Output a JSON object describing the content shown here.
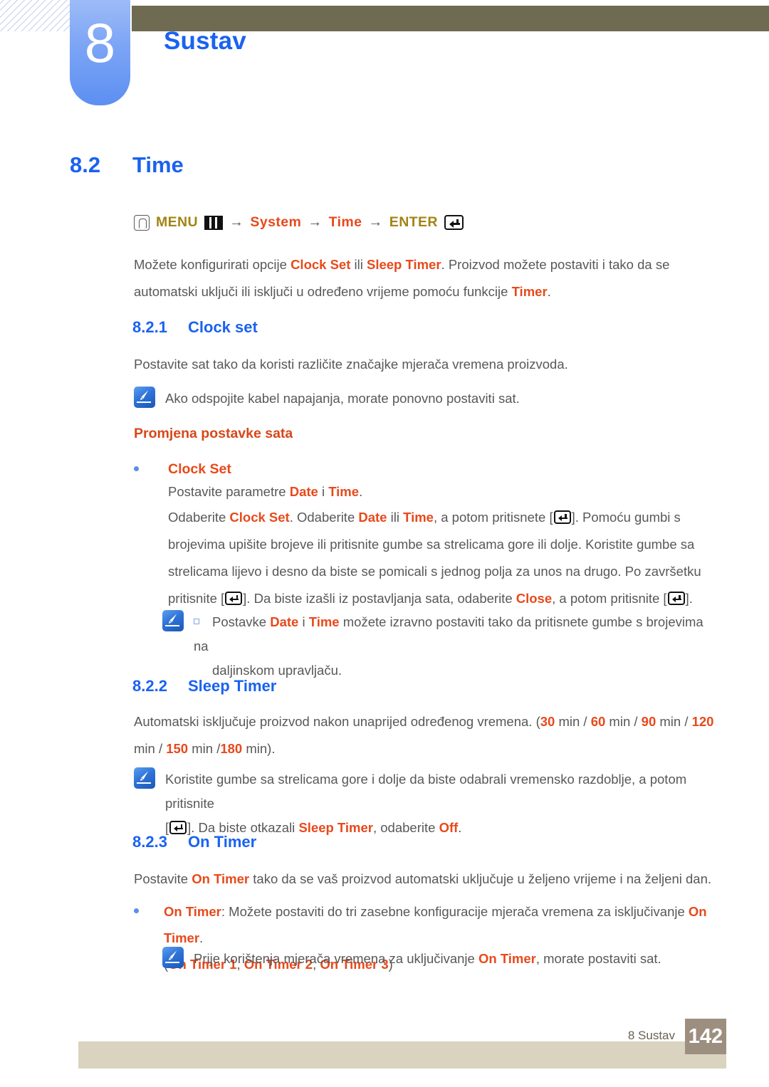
{
  "header": {
    "chapter_number": "8",
    "chapter_title": "Sustav"
  },
  "section": {
    "number": "8.2",
    "title": "Time"
  },
  "menu_path": {
    "menu_label": "MENU",
    "item1": "System",
    "item2": "Time",
    "enter_label": "ENTER",
    "arrow": "→",
    "icons": [
      "hand-press-icon",
      "menu-grid-icon",
      "enter-key-icon"
    ]
  },
  "intro": {
    "line1_a": "Možete konfigurirati opcije ",
    "line1_kw1": "Clock Set",
    "line1_b": " ili ",
    "line1_kw2": "Sleep Timer",
    "line1_c": ". Proizvod možete postaviti i tako da se automatski",
    "line2_a": "uključi ili isključi u određeno vrijeme pomoću funkcije ",
    "line2_kw": "Timer",
    "line2_b": "."
  },
  "clock_set": {
    "number": "8.2.1",
    "title": "Clock set",
    "desc": "Postavite sat tako da koristi različite značajke mjerača vremena proizvoda.",
    "note": "Ako odspojite kabel napajanja, morate ponovno postaviti sat.",
    "subheading": "Promjena postavke sata",
    "bullet_label": "Clock Set",
    "bullet_line_a": "Postavite parametre ",
    "bullet_line_kw1": "Date",
    "bullet_line_b": " i ",
    "bullet_line_kw2": "Time",
    "bullet_line_c": ".",
    "p_l1_a": "Odaberite ",
    "p_l1_kw1": "Clock Set",
    "p_l1_b": ". Odaberite ",
    "p_l1_kw2": "Date",
    "p_l1_c": " ili ",
    "p_l1_kw3": "Time",
    "p_l1_d": ", a potom pritisnete [",
    "p_l1_e": "]. Pomoću gumbi s brojevima",
    "p_l2": "upišite brojeve ili pritisnite gumbe sa strelicama gore ili dolje. Koristite gumbe sa strelicama lijevo i",
    "p_l3_a": "desno da biste se pomicali s jednog polja za unos na drugo. Po završetku pritisnite [",
    "p_l3_b": "]. Da biste",
    "p_l4_a": "izašli iz postavljanja sata, odaberite ",
    "p_l4_kw": "Close",
    "p_l4_b": ", a potom pritisnite [",
    "p_l4_c": "].",
    "note2_a": "Postavke ",
    "note2_kw1": "Date",
    "note2_b": " i ",
    "note2_kw2": "Time",
    "note2_c": " možete izravno postaviti tako da pritisnete gumbe s brojevima na",
    "note2_d": "daljinskom upravljaču."
  },
  "sleep_timer": {
    "number": "8.2.2",
    "title": "Sleep Timer",
    "desc_a": "Automatski isključuje proizvod nakon unaprijed određenog vremena. (",
    "opt1": "30",
    "opt1_unit": " min / ",
    "opt2": "60",
    "opt2_unit": " min / ",
    "opt3": "90",
    "opt3_unit": " min / ",
    "opt4": "120",
    "opt4_unit": " min",
    "desc_b": "/ ",
    "opt5": "150",
    "opt5_unit": " min /",
    "opt6": "180",
    "opt6_unit": " min).",
    "note_l1": "Koristite gumbe sa strelicama gore i dolje da biste odabrali vremensko razdoblje, a potom pritisnite",
    "note_l2_a": "[",
    "note_l2_b": "]. Da biste otkazali ",
    "note_l2_kw1": "Sleep Timer",
    "note_l2_c": ", odaberite ",
    "note_l2_kw2": "Off",
    "note_l2_d": "."
  },
  "on_timer": {
    "number": "8.2.3",
    "title": "On Timer",
    "desc_a": "Postavite ",
    "desc_kw": "On Timer",
    "desc_b": " tako da se vaš proizvod automatski uključuje u željeno vrijeme i na željeni dan.",
    "bullet_kw1": "On Timer",
    "bullet_a": ": Možete postaviti do tri zasebne konfiguracije mjerača vremena za isključivanje ",
    "bullet_kw2": "On Timer",
    "bullet_b": ".",
    "bullet_l2_open": "(",
    "bullet_l2_kw1": "On Timer 1",
    "bullet_l2_sep1": ", ",
    "bullet_l2_kw2": "On Timer 2",
    "bullet_l2_sep2": ", ",
    "bullet_l2_kw3": "On Timer 3",
    "bullet_l2_close": ")",
    "note_a": "Prije korištenja mjerača vremena za uključivanje ",
    "note_kw": "On Timer",
    "note_b": ", morate postaviti sat."
  },
  "footer": {
    "text": "8 Sustav",
    "page": "142"
  },
  "colors": {
    "heading_blue": "#1a62f0",
    "keyword_red": "#e8491b",
    "menu_olive": "#a38314",
    "body_gray": "#58585a",
    "header_bar": "#6f6b52",
    "footer_bar": "#d9d3bf",
    "page_box": "#9d8f80"
  }
}
